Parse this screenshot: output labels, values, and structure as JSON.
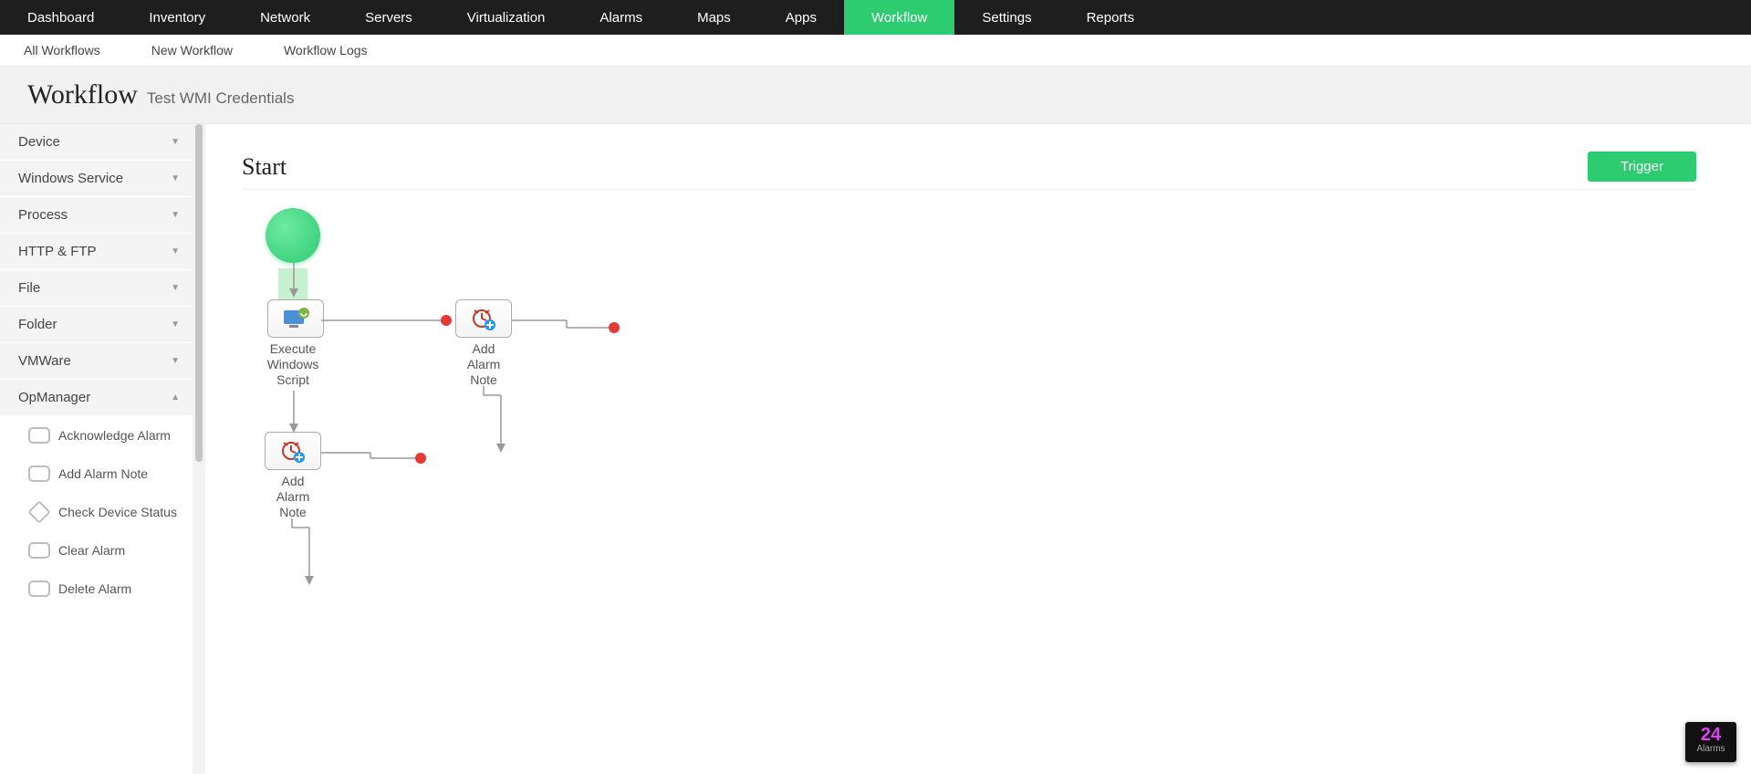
{
  "topnav": [
    {
      "label": "Dashboard",
      "active": false
    },
    {
      "label": "Inventory",
      "active": false
    },
    {
      "label": "Network",
      "active": false
    },
    {
      "label": "Servers",
      "active": false
    },
    {
      "label": "Virtualization",
      "active": false
    },
    {
      "label": "Alarms",
      "active": false
    },
    {
      "label": "Maps",
      "active": false
    },
    {
      "label": "Apps",
      "active": false
    },
    {
      "label": "Workflow",
      "active": true
    },
    {
      "label": "Settings",
      "active": false
    },
    {
      "label": "Reports",
      "active": false
    }
  ],
  "subnav": [
    {
      "label": "All Workflows"
    },
    {
      "label": "New Workflow"
    },
    {
      "label": "Workflow Logs"
    }
  ],
  "title": {
    "h1": "Workflow",
    "sub": "Test WMI Credentials"
  },
  "sidebar": {
    "categories": [
      {
        "label": "Device",
        "expanded": false
      },
      {
        "label": "Windows Service",
        "expanded": false
      },
      {
        "label": "Process",
        "expanded": false
      },
      {
        "label": "HTTP & FTP",
        "expanded": false
      },
      {
        "label": "File",
        "expanded": false
      },
      {
        "label": "Folder",
        "expanded": false
      },
      {
        "label": "VMWare",
        "expanded": false
      },
      {
        "label": "OpManager",
        "expanded": true,
        "items": [
          {
            "label": "Acknowledge Alarm",
            "shape": "box"
          },
          {
            "label": "Add Alarm Note",
            "shape": "box"
          },
          {
            "label": "Check Device Status",
            "shape": "diamond"
          },
          {
            "label": "Clear Alarm",
            "shape": "box"
          },
          {
            "label": "Delete Alarm",
            "shape": "box"
          }
        ]
      }
    ]
  },
  "canvas": {
    "heading": "Start",
    "trigger_btn": "Trigger",
    "nodes": {
      "start": {
        "type": "start"
      },
      "exec": {
        "label": "Execute Windows Script"
      },
      "note1": {
        "label": "Add Alarm Note"
      },
      "note2": {
        "label": "Add Alarm Note"
      }
    }
  },
  "alarm_badge": {
    "count": "24",
    "label": "Alarms"
  }
}
